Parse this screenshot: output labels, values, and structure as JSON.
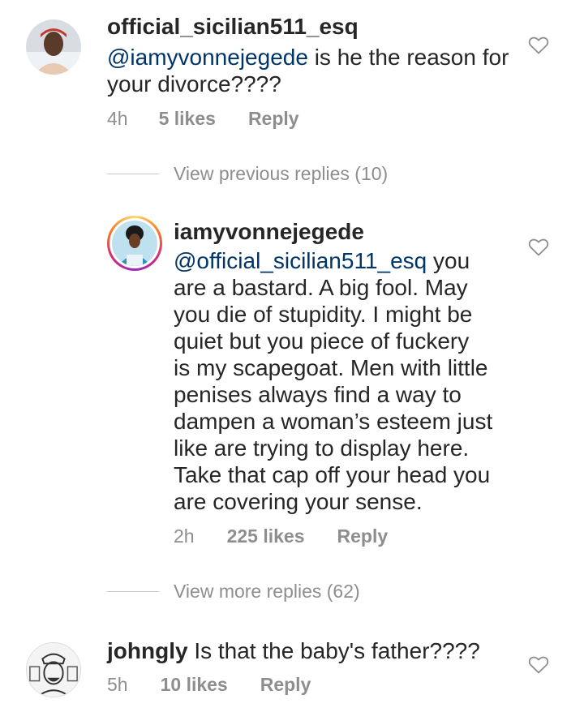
{
  "comments": [
    {
      "username": "official_sicilian511_esq",
      "mention": "@iamyvonnejegede",
      "body": " is he the reason for your divorce????",
      "time": "4h",
      "likes": "5 likes",
      "reply": "Reply"
    },
    {
      "username": "johngly",
      "mention": "",
      "body": "Is that the baby's father????",
      "time": "5h",
      "likes": "10 likes",
      "reply": "Reply"
    }
  ],
  "view_previous": "View previous replies (10)",
  "reply_comment": {
    "username": "iamyvonnejegede",
    "mention": "@official_sicilian511_esq",
    "body_lines": [
      " you",
      "are a bastard. A big fool. May",
      "you die of stupidity. I might be",
      "quiet but you piece of fuckery",
      "is my scapegoat. Men with little",
      "penises always find a way to",
      "dampen a woman’s esteem just",
      "like are trying to display here.",
      "Take that cap off your head you",
      "are covering your sense."
    ],
    "time": "2h",
    "likes": "225 likes",
    "reply": "Reply"
  },
  "view_more": "View more replies (62)",
  "colors": {
    "text": "#262626",
    "mention": "#003569",
    "meta": "#8e8e8e",
    "divider": "#c7c7c7"
  },
  "icons": {
    "like": "heart-outline-icon"
  }
}
